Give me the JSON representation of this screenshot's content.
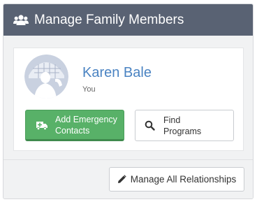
{
  "header": {
    "title": "Manage Family Members",
    "icon": "users-icon"
  },
  "member": {
    "name": "Karen Bale",
    "role": "You",
    "avatar_icon": "avatar-photo"
  },
  "buttons": {
    "emergency_line1": "Add Emergency",
    "emergency_line2": "Contacts",
    "emergency_icon": "ambulance-icon",
    "find_line1": "Find",
    "find_line2": "Programs",
    "find_icon": "search-icon",
    "manage": "Manage All Relationships",
    "manage_icon": "pencil-icon"
  },
  "colors": {
    "header_bg": "#596273",
    "accent_blue": "#4a83c2",
    "green_button": "#58b168"
  }
}
